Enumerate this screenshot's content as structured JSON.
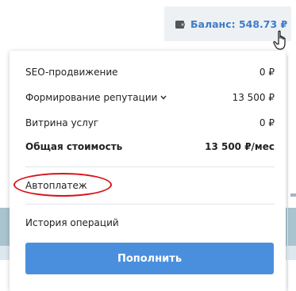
{
  "header": {
    "balance_label": "Баланс: 548.73 ₽",
    "wallet_icon": "wallet-icon",
    "cursor_icon": "hand-pointer-icon"
  },
  "dropdown": {
    "items": [
      {
        "label": "SEO-продвижение",
        "value": "0 ₽"
      },
      {
        "label": "Формирование репутации",
        "value": "13 500 ₽",
        "has_chevron": true
      },
      {
        "label": "Витрина услуг",
        "value": "0 ₽"
      }
    ],
    "total": {
      "label": "Общая стоимость",
      "value": "13 500 ₽/мес"
    },
    "autopay_label": "Автоплатеж",
    "history_label": "История операций",
    "topup_label": "Пополнить"
  },
  "colors": {
    "accent": "#4a8fdd",
    "balance_text": "#3d7cc9",
    "annotation": "#d8131b"
  }
}
